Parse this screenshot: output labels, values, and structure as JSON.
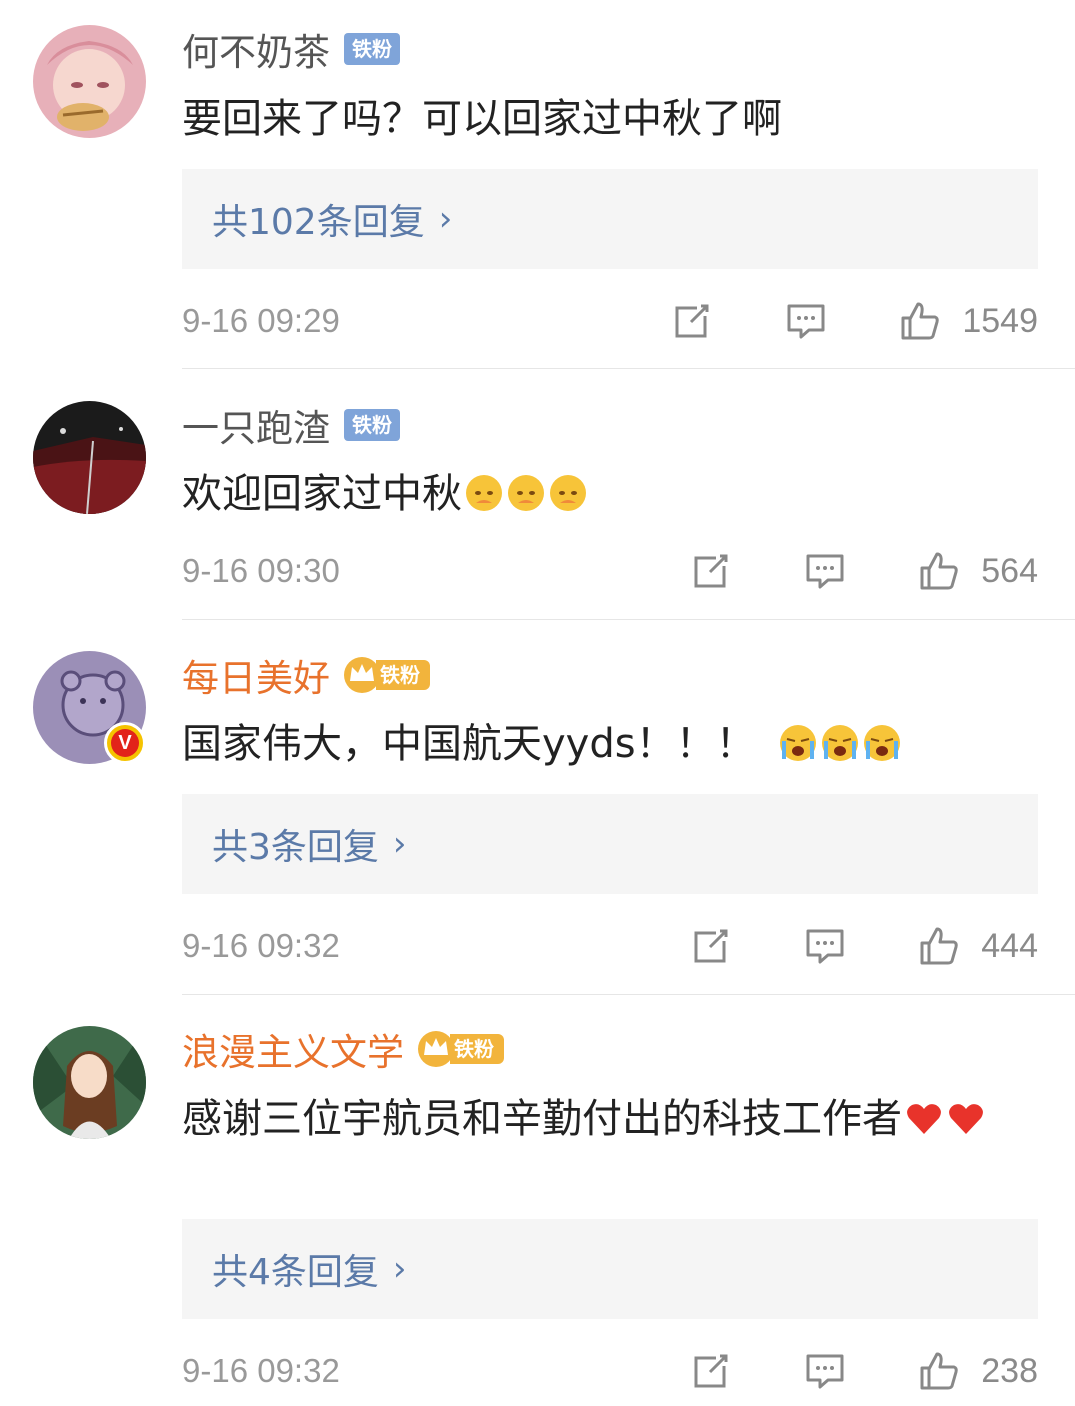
{
  "comments": [
    {
      "name": "何不奶茶",
      "badge": "铁粉",
      "text": "要回来了吗？可以回家过中秋了啊",
      "reply": "共102条回复",
      "time": "9-16 09:29",
      "likes": "1549"
    },
    {
      "name": "一只跑渣",
      "badge": "铁粉",
      "text": "欢迎回家过中秋",
      "time": "9-16 09:30",
      "likes": "564"
    },
    {
      "name": "每日美好",
      "badge": "铁粉",
      "text": "国家伟大，中国航天yyds！！！",
      "reply": "共3条回复",
      "time": "9-16 09:32",
      "likes": "444"
    },
    {
      "name": "浪漫主义文学",
      "badge": "铁粉",
      "text": "感谢三位宇航员和辛勤付出的科技工作者",
      "reply": "共4条回复",
      "time": "9-16 09:32",
      "likes": "238"
    }
  ],
  "icons": {
    "share": "share-icon",
    "comment": "comment-icon",
    "like": "thumbs-up-icon",
    "reply_chevron": "chevron-right-icon"
  },
  "colors": {
    "reply_link": "#5b7aa8",
    "fan_badge_blue": "#7fa4d9",
    "fan_badge_gold": "#f2b43c",
    "vip_name": "#e8722c"
  }
}
